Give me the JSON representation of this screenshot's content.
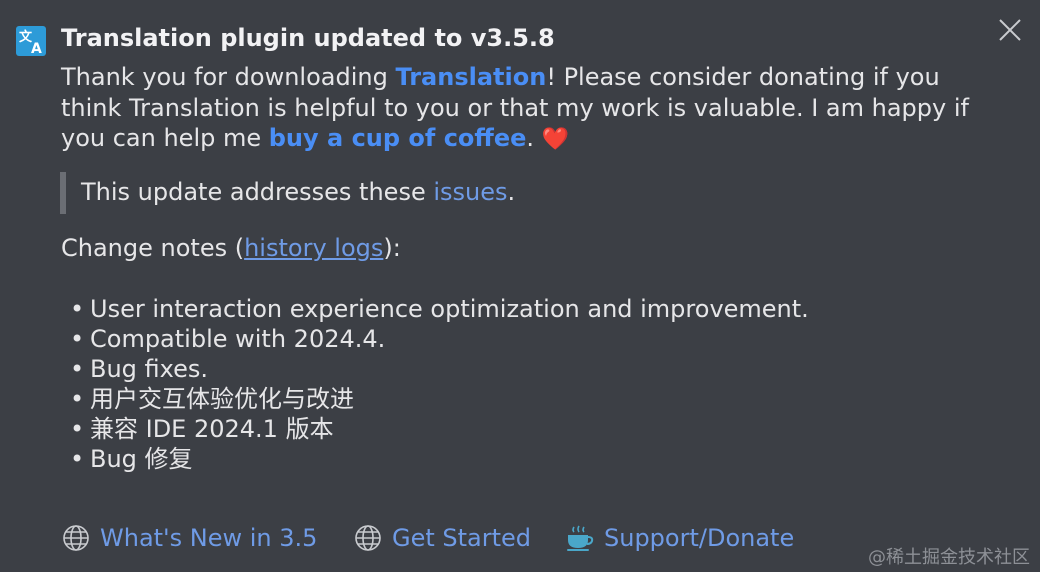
{
  "notification": {
    "icon": "translate-icon",
    "title": "Translation plugin updated to v3.5.8",
    "intro": {
      "part1": "Thank you for downloading ",
      "link1": "Translation",
      "part2": "! Please consider donating if you think Translation is helpful to you or that my work is valuable. I am happy if you can help me ",
      "link2": "buy a cup of coffee",
      "part3": ". ",
      "heart": "❤️"
    },
    "quote": {
      "text": "This update addresses these ",
      "link": "issues",
      "tail": "."
    },
    "change_notes": {
      "prefix": "Change notes (",
      "link": "history logs",
      "suffix": "):"
    },
    "items": [
      "User interaction experience optimization and improvement.",
      "Compatible with 2024.4.",
      "Bug fixes.",
      "用户交互体验优化与改进",
      "兼容 IDE 2024.1 版本",
      "Bug 修复"
    ],
    "bullet": "•",
    "actions": [
      {
        "label": "What's New in 3.5",
        "icon": "globe-icon"
      },
      {
        "label": "Get Started",
        "icon": "globe-icon"
      },
      {
        "label": "Support/Donate",
        "icon": "coffee-cup-icon"
      }
    ]
  },
  "watermark": "@稀土掘金技术社区",
  "colors": {
    "background": "#3c3f45",
    "text": "#e6e6e8",
    "link": "#4a8ef5",
    "soft_link": "#6f9be6",
    "heart": "#e03131",
    "icon_blue": "#2d9bd8"
  }
}
